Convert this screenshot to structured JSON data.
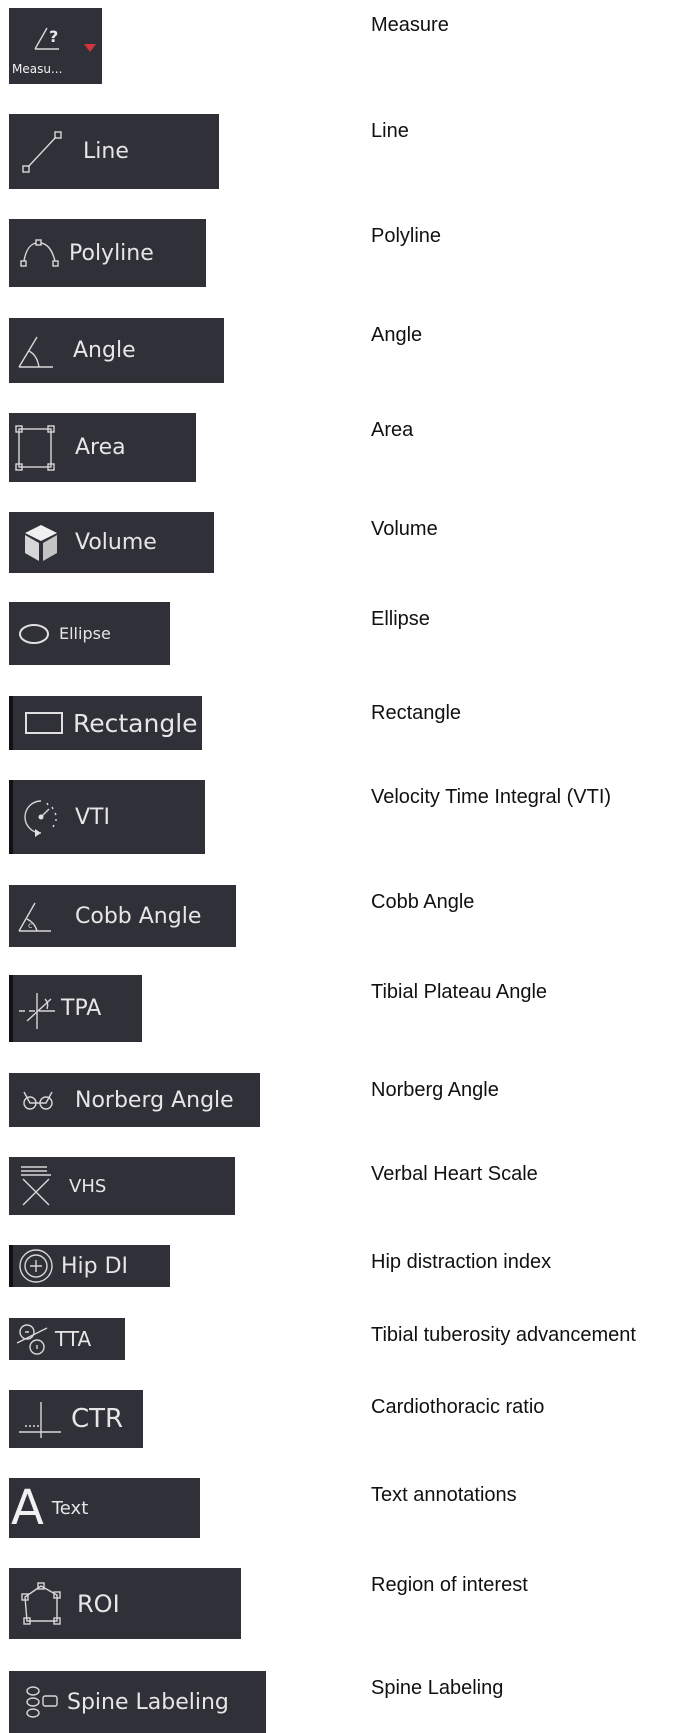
{
  "colors": {
    "button_bg": "#2f3038",
    "button_text": "#e6e6e6",
    "accent_dropdown": "#d0343c",
    "description_text": "#111111"
  },
  "tools": [
    {
      "id": "measure",
      "label": "Measu...",
      "icon": "angle-question-icon",
      "description": "Measure"
    },
    {
      "id": "line",
      "label": "Line",
      "icon": "line-icon",
      "description": "Line"
    },
    {
      "id": "polyline",
      "label": "Polyline",
      "icon": "polyline-icon",
      "description": "Polyline"
    },
    {
      "id": "angle",
      "label": "Angle",
      "icon": "angle-icon",
      "description": "Angle"
    },
    {
      "id": "area",
      "label": "Area",
      "icon": "area-icon",
      "description": "Area"
    },
    {
      "id": "volume",
      "label": "Volume",
      "icon": "cube-icon",
      "description": "Volume"
    },
    {
      "id": "ellipse",
      "label": "Ellipse",
      "icon": "ellipse-icon",
      "description": "Ellipse"
    },
    {
      "id": "rectangle",
      "label": "Rectangle",
      "icon": "rectangle-icon",
      "description": "Rectangle"
    },
    {
      "id": "vti",
      "label": "VTI",
      "icon": "vti-gauge-icon",
      "description": "Velocity Time Integral (VTI)"
    },
    {
      "id": "cobb",
      "label": "Cobb Angle",
      "icon": "cobb-angle-icon",
      "description": "Cobb Angle"
    },
    {
      "id": "tpa",
      "label": "TPA",
      "icon": "tpa-icon",
      "description": "Tibial Plateau Angle"
    },
    {
      "id": "norberg",
      "label": "Norberg Angle",
      "icon": "norberg-angle-icon",
      "description": "Norberg Angle"
    },
    {
      "id": "vhs",
      "label": "VHS",
      "icon": "vhs-icon",
      "description": "Verbal Heart Scale"
    },
    {
      "id": "hipdi",
      "label": "Hip DI",
      "icon": "hip-di-icon",
      "description": "Hip distraction index"
    },
    {
      "id": "tta",
      "label": "TTA",
      "icon": "tta-icon",
      "description": "Tibial tuberosity advancement"
    },
    {
      "id": "ctr",
      "label": "CTR",
      "icon": "ctr-icon",
      "description": "Cardiothoracic ratio"
    },
    {
      "id": "text",
      "label": "Text",
      "icon": "text-a-icon",
      "description": "Text annotations"
    },
    {
      "id": "roi",
      "label": "ROI",
      "icon": "roi-icon",
      "description": "Region of interest"
    },
    {
      "id": "spine",
      "label": "Spine Labeling",
      "icon": "spine-labeling-icon",
      "description": "Spine Labeling"
    }
  ]
}
